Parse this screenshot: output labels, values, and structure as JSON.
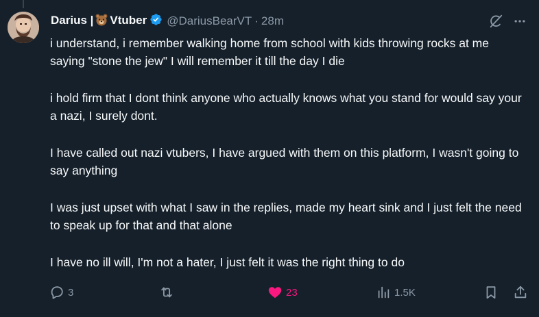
{
  "tweet": {
    "display_name_part1": "Darius |",
    "display_name_part2": "Vtuber",
    "handle": "@DariusBearVT",
    "separator": "·",
    "time": "28m",
    "paragraphs": [
      "i understand, i remember walking home from school with kids throwing rocks at me saying \"stone the jew\" I will remember it till the day I die",
      "i hold firm that I dont think anyone who actually knows what you stand for would say your a nazi, I surely dont.",
      "I have called out nazi vtubers, I have argued with them on this platform, I wasn't going to say anything",
      "I was just upset with what I saw in the replies, made my heart sink and I just felt the need to speak up for that and that alone",
      "I have no ill will, I'm not a hater, I just felt it was the right thing to do"
    ]
  },
  "actions": {
    "replies": "3",
    "retweets": "",
    "likes": "23",
    "views": "1.5K"
  },
  "icons": {
    "verified": "verified-badge-icon",
    "bear": "bear-emoji-icon",
    "grok": "grok-icon",
    "more": "more-icon",
    "reply": "reply-icon",
    "retweet": "retweet-icon",
    "like": "heart-icon",
    "views": "views-icon",
    "bookmark": "bookmark-icon",
    "share": "share-icon"
  },
  "colors": {
    "background": "#15202b",
    "text": "#f7f9f9",
    "secondary": "#8b98a5",
    "like": "#f91880",
    "verified": "#1d9bf0"
  }
}
